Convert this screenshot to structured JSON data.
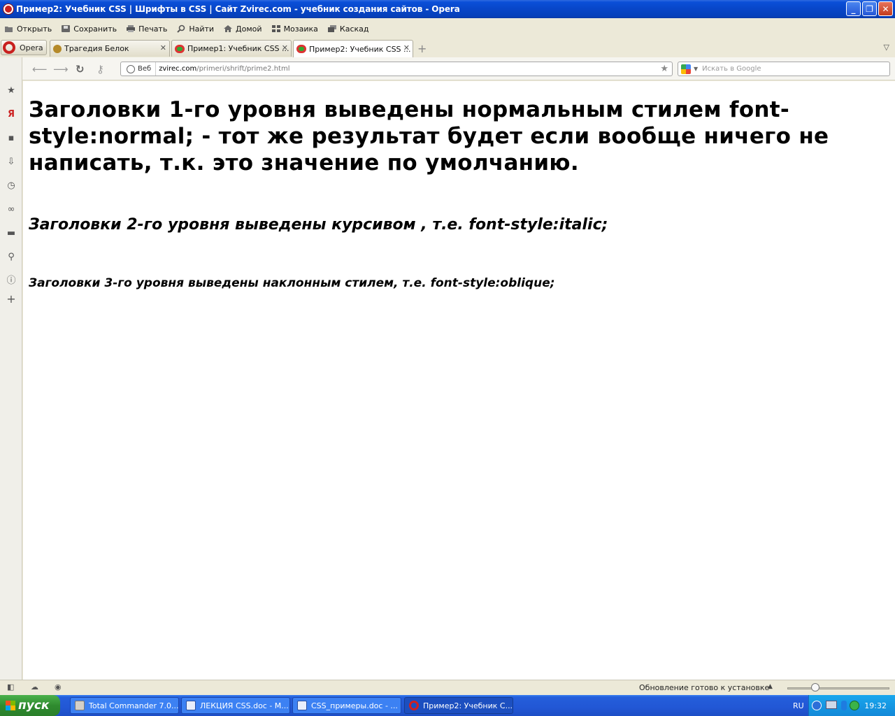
{
  "window": {
    "title": "Пример2: Учебник CSS | Шрифты в CSS | Сайт Zvirec.com - учебник создания сайтов - Opera"
  },
  "toolbar": {
    "items": [
      {
        "label": "Открыть",
        "icon": "folder-open-icon"
      },
      {
        "label": "Сохранить",
        "icon": "save-icon"
      },
      {
        "label": "Печать",
        "icon": "print-icon"
      },
      {
        "label": "Найти",
        "icon": "find-icon"
      },
      {
        "label": "Домой",
        "icon": "home-icon"
      },
      {
        "label": "Мозаика",
        "icon": "tile-icon"
      },
      {
        "label": "Каскад",
        "icon": "cascade-icon"
      }
    ]
  },
  "tabs": {
    "opera_label": "Opera",
    "items": [
      {
        "label": "Трагедия Белок",
        "active": false
      },
      {
        "label": "Пример1: Учебник CSS ...",
        "active": false
      },
      {
        "label": "Пример2: Учебник CSS ...",
        "active": true
      }
    ]
  },
  "address": {
    "web_label": "Веб",
    "url_host": "zvirec.com",
    "url_path": "/primeri/shrift/prime2.html",
    "search_placeholder": "Искать в Google"
  },
  "content": {
    "h1": "Заголовки 1-го уровня выведены нормальным стилем font-style:normal; - тот же результат будет если вообще ничего не написать, т.к. это значение по умолчанию.",
    "h2": "Заголовки 2-го уровня выведены курсивом , т.е. font-style:italic;",
    "h3": "Заголовки 3-го уровня выведены наклонным стилем, т.е. font-style:oblique;"
  },
  "statusbar": {
    "update_text": "Обновление готово к установке"
  },
  "taskbar": {
    "start_label": "пуск",
    "tasks": [
      {
        "label": "Total Commander 7.0...",
        "active": false
      },
      {
        "label": "ЛЕКЦИЯ CSS.doc - M...",
        "active": false
      },
      {
        "label": "CSS_примеры.doc - ...",
        "active": false
      },
      {
        "label": "Пример2: Учебник С...",
        "active": true
      }
    ],
    "language": "RU",
    "time": "19:32"
  }
}
